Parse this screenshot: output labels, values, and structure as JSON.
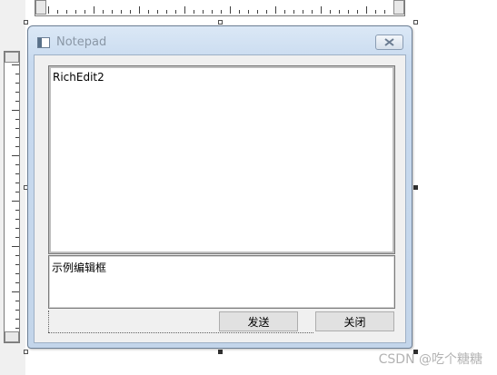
{
  "dialog": {
    "title": "Notepad",
    "richedit_text": "RichEdit2",
    "example_edit_text": "示例编辑框",
    "buttons": {
      "send_label": "发送",
      "close_label": "关闭"
    }
  },
  "watermark": "CSDN @吃个糖糖",
  "icons": {
    "window_icon": "window-icon",
    "close": "close-icon"
  },
  "colors": {
    "dialog_frame": "#c8daef",
    "client_bg": "#f0f0f0",
    "button_bg": "#e1e1e1"
  }
}
